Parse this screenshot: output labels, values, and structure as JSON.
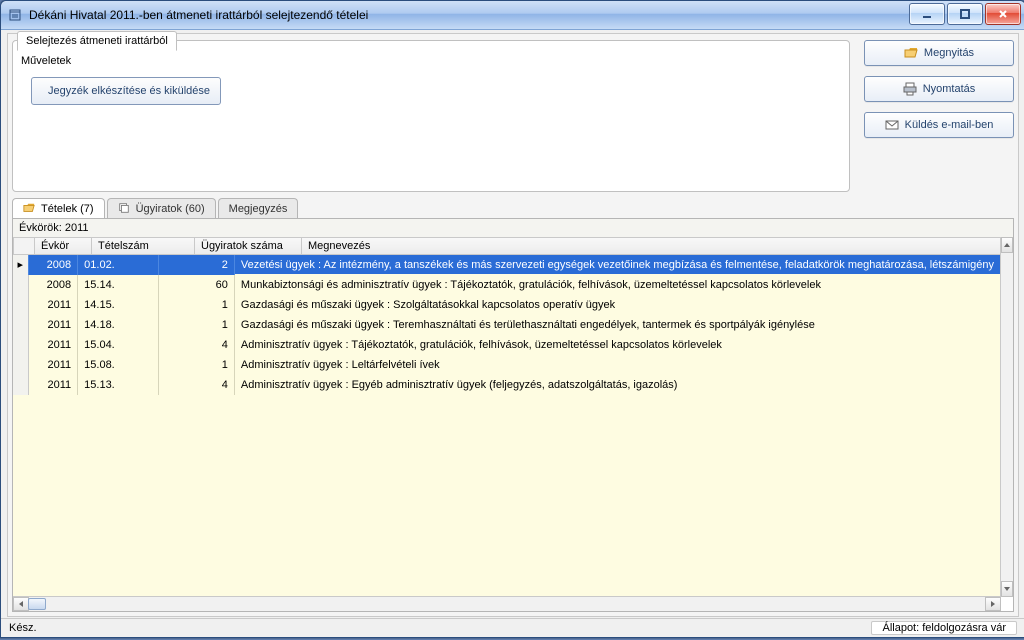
{
  "window": {
    "title": "Dékáni Hivatal 2011.-ben átmeneti irattárból selejtezendő tételei"
  },
  "sidebar": {
    "open": "Megnyitás",
    "print": "Nyomtatás",
    "email": "Küldés e-mail-ben"
  },
  "groupbox": {
    "tab": "Selejtezés átmeneti irattárból",
    "label": "Műveletek",
    "action_button": "Jegyzék elkészítése és kiküldése"
  },
  "tabs": [
    {
      "icon": "folder-open-icon",
      "label": "Tételek (7)"
    },
    {
      "icon": "stack-icon",
      "label": "Ügyiratok (60)"
    },
    {
      "icon": "",
      "label": "Megjegyzés"
    }
  ],
  "grid": {
    "band": "Évkörök: 2011",
    "columns": [
      "Évkör",
      "Tételszám",
      "Ügyiratok száma",
      "Megnevezés"
    ],
    "rows": [
      {
        "ev": "2008",
        "tsz": "01.02.",
        "uszam": "2",
        "megnev": "Vezetési ügyek : Az intézmény, a tanszékek és más szervezeti egységek vezetőinek megbízása és felmentése, feladatkörök meghatározása, létszámigény"
      },
      {
        "ev": "2008",
        "tsz": "15.14.",
        "uszam": "60",
        "megnev": "Munkabiztonsági és adminisztratív ügyek : Tájékoztatók, gratulációk, felhívások, üzemeltetéssel kapcsolatos körlevelek"
      },
      {
        "ev": "2011",
        "tsz": "14.15.",
        "uszam": "1",
        "megnev": "Gazdasági és műszaki ügyek : Szolgáltatásokkal kapcsolatos operatív ügyek"
      },
      {
        "ev": "2011",
        "tsz": "14.18.",
        "uszam": "1",
        "megnev": "Gazdasági és műszaki ügyek : Teremhasználtati és területhasználtati engedélyek, tantermek és sportpályák igénylése"
      },
      {
        "ev": "2011",
        "tsz": "15.04.",
        "uszam": "4",
        "megnev": "Adminisztratív ügyek : Tájékoztatók, gratulációk, felhívások, üzemeltetéssel kapcsolatos körlevelek"
      },
      {
        "ev": "2011",
        "tsz": "15.08.",
        "uszam": "1",
        "megnev": "Adminisztratív ügyek : Leltárfelvételi ívek"
      },
      {
        "ev": "2011",
        "tsz": "15.13.",
        "uszam": "4",
        "megnev": "Adminisztratív ügyek : Egyéb adminisztratív ügyek (feljegyzés, adatszolgáltatás, igazolás)"
      }
    ],
    "selected_index": 0
  },
  "statusbar": {
    "left": "Kész.",
    "state": "Állapot: feldolgozásra vár"
  }
}
